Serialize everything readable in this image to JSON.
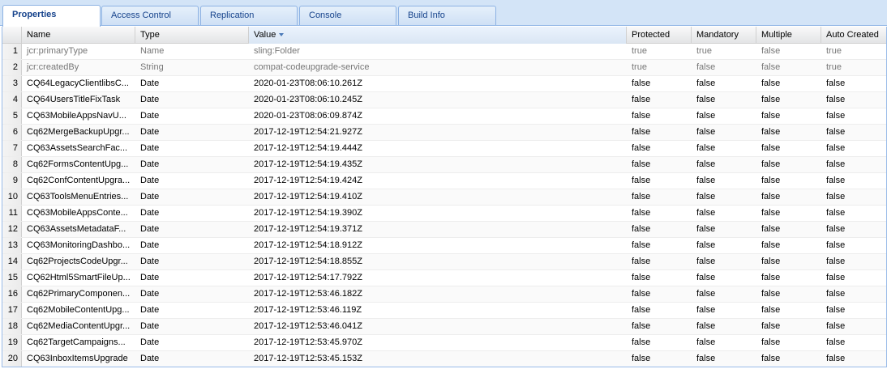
{
  "tabs": [
    {
      "label": "Properties",
      "active": true
    },
    {
      "label": "Access Control",
      "active": false
    },
    {
      "label": "Replication",
      "active": false
    },
    {
      "label": "Console",
      "active": false
    },
    {
      "label": "Build Info",
      "active": false
    }
  ],
  "table": {
    "columns": [
      "Name",
      "Type",
      "Value",
      "Protected",
      "Mandatory",
      "Multiple",
      "Auto Created"
    ],
    "sorted_column": "Value",
    "rows": [
      [
        "1",
        "jcr:primaryType",
        "Name",
        "sling:Folder",
        "true",
        "true",
        "false",
        "true"
      ],
      [
        "2",
        "jcr:createdBy",
        "String",
        "compat-codeupgrade-service",
        "true",
        "false",
        "false",
        "true"
      ],
      [
        "3",
        "CQ64LegacyClientlibsC...",
        "Date",
        "2020-01-23T08:06:10.261Z",
        "false",
        "false",
        "false",
        "false"
      ],
      [
        "4",
        "CQ64UsersTitleFixTask",
        "Date",
        "2020-01-23T08:06:10.245Z",
        "false",
        "false",
        "false",
        "false"
      ],
      [
        "5",
        "CQ63MobileAppsNavU...",
        "Date",
        "2020-01-23T08:06:09.874Z",
        "false",
        "false",
        "false",
        "false"
      ],
      [
        "6",
        "Cq62MergeBackupUpgr...",
        "Date",
        "2017-12-19T12:54:21.927Z",
        "false",
        "false",
        "false",
        "false"
      ],
      [
        "7",
        "CQ63AssetsSearchFac...",
        "Date",
        "2017-12-19T12:54:19.444Z",
        "false",
        "false",
        "false",
        "false"
      ],
      [
        "8",
        "Cq62FormsContentUpg...",
        "Date",
        "2017-12-19T12:54:19.435Z",
        "false",
        "false",
        "false",
        "false"
      ],
      [
        "9",
        "Cq62ConfContentUpgra...",
        "Date",
        "2017-12-19T12:54:19.424Z",
        "false",
        "false",
        "false",
        "false"
      ],
      [
        "10",
        "CQ63ToolsMenuEntries...",
        "Date",
        "2017-12-19T12:54:19.410Z",
        "false",
        "false",
        "false",
        "false"
      ],
      [
        "11",
        "CQ63MobileAppsConte...",
        "Date",
        "2017-12-19T12:54:19.390Z",
        "false",
        "false",
        "false",
        "false"
      ],
      [
        "12",
        "CQ63AssetsMetadataF...",
        "Date",
        "2017-12-19T12:54:19.371Z",
        "false",
        "false",
        "false",
        "false"
      ],
      [
        "13",
        "CQ63MonitoringDashbo...",
        "Date",
        "2017-12-19T12:54:18.912Z",
        "false",
        "false",
        "false",
        "false"
      ],
      [
        "14",
        "Cq62ProjectsCodeUpgr...",
        "Date",
        "2017-12-19T12:54:18.855Z",
        "false",
        "false",
        "false",
        "false"
      ],
      [
        "15",
        "CQ62Html5SmartFileUp...",
        "Date",
        "2017-12-19T12:54:17.792Z",
        "false",
        "false",
        "false",
        "false"
      ],
      [
        "16",
        "Cq62PrimaryComponen...",
        "Date",
        "2017-12-19T12:53:46.182Z",
        "false",
        "false",
        "false",
        "false"
      ],
      [
        "17",
        "Cq62MobileContentUpg...",
        "Date",
        "2017-12-19T12:53:46.119Z",
        "false",
        "false",
        "false",
        "false"
      ],
      [
        "18",
        "Cq62MediaContentUpgr...",
        "Date",
        "2017-12-19T12:53:46.041Z",
        "false",
        "false",
        "false",
        "false"
      ],
      [
        "19",
        "Cq62TargetCampaigns...",
        "Date",
        "2017-12-19T12:53:45.970Z",
        "false",
        "false",
        "false",
        "false"
      ],
      [
        "20",
        "CQ63InboxItemsUpgrade",
        "Date",
        "2017-12-19T12:53:45.153Z",
        "false",
        "false",
        "false",
        "false"
      ]
    ]
  }
}
